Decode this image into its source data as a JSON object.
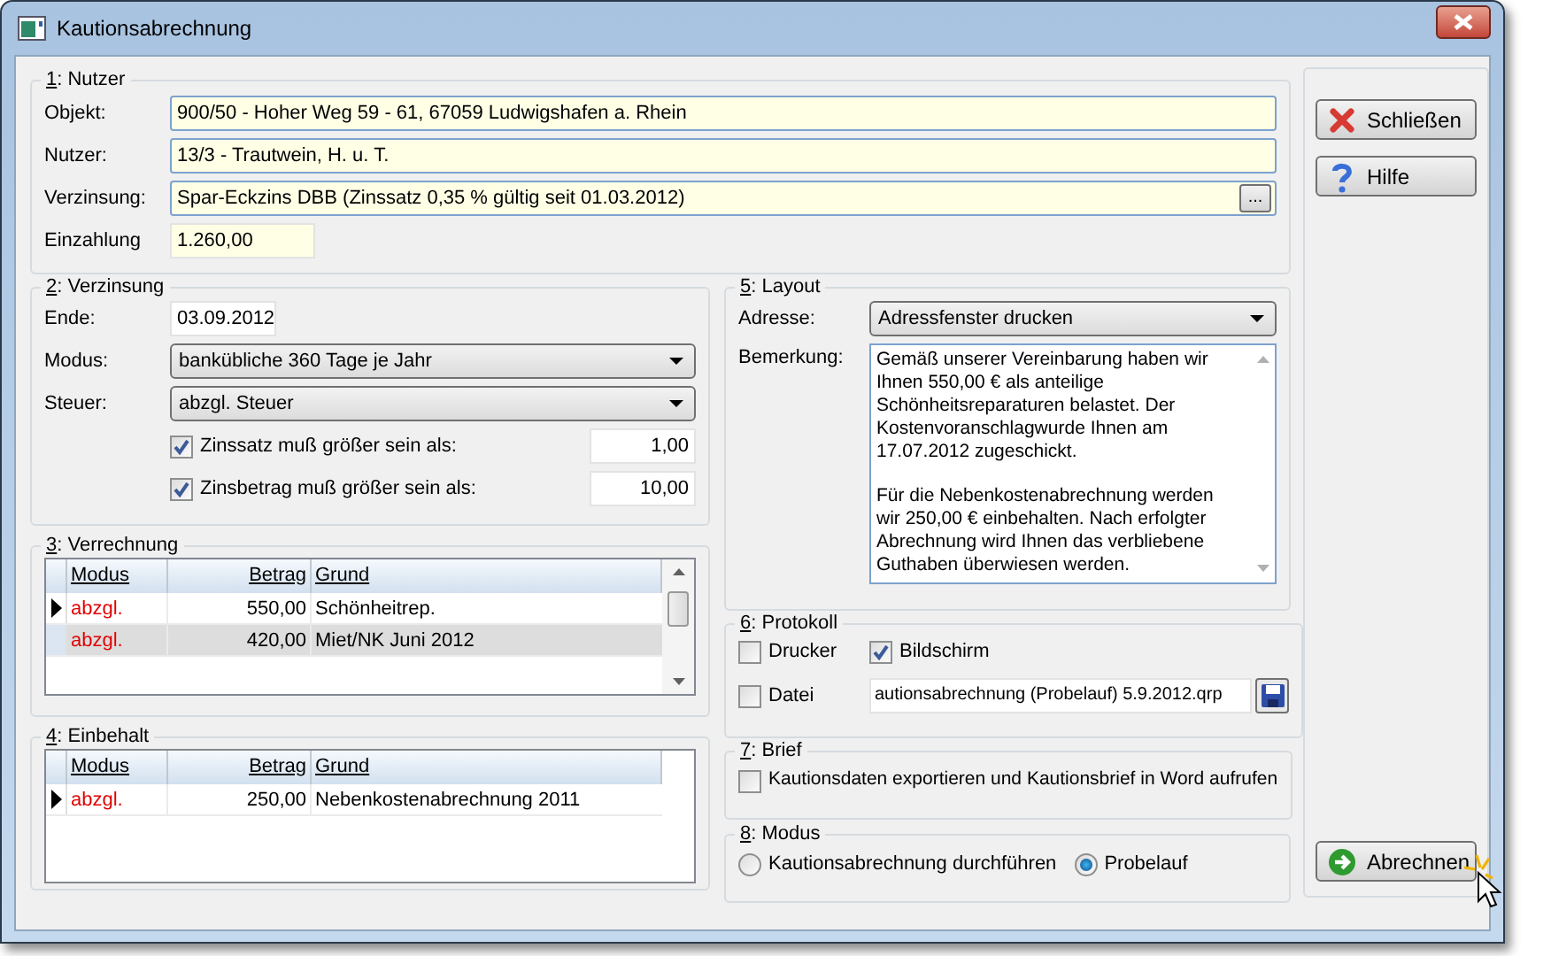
{
  "window": {
    "title": "Kautionsabrechnung"
  },
  "nutzer": {
    "title": "1: Nutzer",
    "fields": [
      {
        "kind": "text",
        "label": "Objekt:",
        "value": "900/50 - Hoher Weg 59 - 61, 67059 Ludwigshafen a. Rhein"
      },
      {
        "kind": "text",
        "label": "Nutzer:",
        "value": "13/3 - Trautwein, H. u. T."
      },
      {
        "kind": "browse",
        "label": "Verzinsung:",
        "value": "Spar-Eckzins DBB  (Zinssatz 0,35 % gültig seit 01.03.2012)",
        "button": "..."
      },
      {
        "kind": "amount",
        "label": "Einzahlung",
        "value": "1.260,00"
      }
    ]
  },
  "verzinsung": {
    "title": "2: Verzinsung",
    "ende": {
      "label": "Ende:",
      "value": "03.09.2012"
    },
    "combos": [
      {
        "label": "Modus:",
        "value": "bankübliche 360 Tage je Jahr"
      },
      {
        "label": "Steuer:",
        "value": "abzgl. Steuer"
      }
    ],
    "checks": [
      {
        "label": "Zinssatz muß größer sein als:",
        "checked": true,
        "value": "1,00"
      },
      {
        "label": "Zinsbetrag muß größer sein als:",
        "checked": true,
        "value": "10,00"
      }
    ]
  },
  "verrechnung": {
    "title": "3: Verrechnung",
    "columns": [
      "Modus",
      "Betrag",
      "Grund"
    ],
    "rows": [
      {
        "modus": "abzgl.",
        "betrag": "550,00",
        "grund": "Schönheitrep.",
        "current": true,
        "selected": false
      },
      {
        "modus": "abzgl.",
        "betrag": "420,00",
        "grund": "Miet/NK Juni 2012",
        "current": false,
        "selected": true
      }
    ]
  },
  "einbehalt": {
    "title": "4: Einbehalt",
    "columns": [
      "Modus",
      "Betrag",
      "Grund"
    ],
    "rows": [
      {
        "modus": "abzgl.",
        "betrag": "250,00",
        "grund": "Nebenkostenabrechnung 2011",
        "current": true,
        "selected": false
      }
    ]
  },
  "layout": {
    "title": "5: Layout",
    "adresse": {
      "label": "Adresse:",
      "value": "Adressfenster drucken"
    },
    "bemerkung": {
      "label": "Bemerkung:",
      "value": "Gemäß unserer Vereinbarung haben wir\nIhnen 550,00 € als anteilige\nSchönheitsreparaturen belastet. Der\nKostenvoranschlagwurde Ihnen am\n17.07.2012 zugeschickt.\n\nFür die Nebenkostenabrechnung werden\nwir 250,00 € einbehalten. Nach erfolgter\nAbrechnung wird Ihnen das verbliebene\nGuthaben überwiesen werden."
    }
  },
  "protokoll": {
    "title": "6: Protokoll",
    "options": [
      {
        "label": "Drucker",
        "checked": false
      },
      {
        "label": "Bildschirm",
        "checked": true
      }
    ],
    "datei": {
      "label": "Datei",
      "checked": false,
      "value": "autionsabrechnung  (Probelauf) 5.9.2012.qrp"
    }
  },
  "brief": {
    "title": "7: Brief",
    "option": {
      "label": "Kautionsdaten exportieren und Kautionsbrief in Word aufrufen",
      "checked": false
    }
  },
  "modus": {
    "title": "8: Modus",
    "options": [
      {
        "label": "Kautionsabrechnung durchführen",
        "selected": false
      },
      {
        "label": "Probelauf",
        "selected": true
      }
    ]
  },
  "buttons": [
    {
      "label": "Schließen",
      "kind": "close"
    },
    {
      "label": "Hilfe",
      "kind": "help"
    },
    {
      "label": "Abrechnen",
      "kind": "run"
    }
  ]
}
